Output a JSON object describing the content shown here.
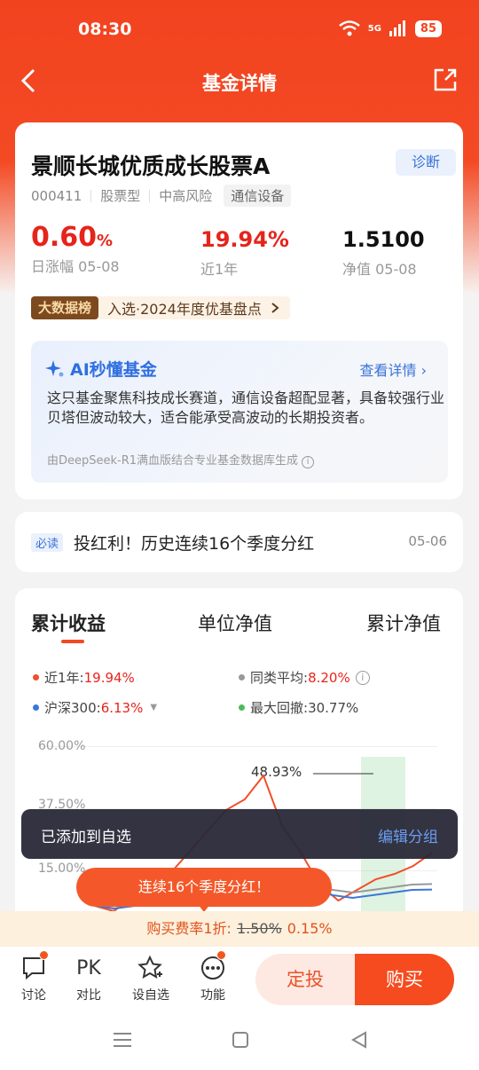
{
  "status_bar": {
    "time": "08:30",
    "network": "5G",
    "battery": "85"
  },
  "nav": {
    "title": "基金详情"
  },
  "fund": {
    "name": "景顺长城优质成长股票A",
    "diagnose_label": "诊断",
    "code": "000411",
    "type": "股票型",
    "risk": "中高风险",
    "industry": "通信设备",
    "daily_change_value": "0.60",
    "daily_change_unit": "%",
    "daily_change_label": "日涨幅 05-08",
    "year_return": "19.94%",
    "year_return_label": "近1年",
    "nav_value": "1.5100",
    "nav_label": "净值 05-08",
    "rank_badge": "大数据榜",
    "rank_text": "入选·2024年度优基盘点"
  },
  "ai": {
    "title": "AI秒懂基金",
    "more": "查看详情",
    "text": "这只基金聚焦科技成长赛道，通信设备超配显著，具备较强行业贝塔但波动较大，适合能承受高波动的长期投资者。",
    "source": "由DeepSeek-R1满血版结合专业基金数据库生成"
  },
  "news": {
    "tag": "必读",
    "title": "投红利！历史连续16个季度分红",
    "date": "05-06"
  },
  "chart_tabs": [
    "累计收益",
    "单位净值",
    "累计净值"
  ],
  "legend": {
    "near_year_label": "近1年:",
    "near_year_value": "19.94%",
    "peer_label": "同类平均:",
    "peer_value": "8.20%",
    "hs300_label": "沪深300:",
    "hs300_value": "6.13%",
    "drawdown_label": "最大回撤:",
    "drawdown_value": "30.77%"
  },
  "colors": {
    "fund_line": "#f0502a",
    "peer_line": "#999999",
    "hs300_line": "#3a78d8",
    "drawdown": "#4cbb5c",
    "accent": "#f24a1f"
  },
  "chart_data": {
    "type": "line",
    "y_ticks": [
      "60.00%",
      "37.50%",
      "15.00%"
    ],
    "peak_label": "48.93%",
    "series": [
      {
        "name": "近1年",
        "values": [
          0,
          -2,
          3,
          8,
          12,
          20,
          28,
          36,
          40,
          48.93,
          30,
          20,
          8,
          2,
          6,
          10,
          12,
          15,
          19.94
        ]
      },
      {
        "name": "同类平均",
        "values": [
          0,
          -1,
          1,
          3,
          5,
          8,
          10,
          12,
          13,
          14,
          10,
          8,
          6,
          5,
          6,
          7,
          8,
          8.2
        ]
      },
      {
        "name": "沪深300",
        "values": [
          0,
          -1,
          0,
          2,
          3,
          5,
          6,
          8,
          9,
          10,
          7,
          6,
          4,
          3,
          4,
          5,
          6,
          6.13
        ]
      }
    ]
  },
  "toast": {
    "message": "已添加到自选",
    "action": "编辑分组"
  },
  "promo": {
    "text": "连续16个季度分红！"
  },
  "fee": {
    "label": "购买费率1折:",
    "old": "1.50%",
    "new": "0.15%"
  },
  "bottom": {
    "discuss": "讨论",
    "compare": "对比",
    "compare_icon": "PK",
    "watchlist": "设自选",
    "functions": "功能",
    "fixed_invest": "定投",
    "buy": "购买"
  }
}
